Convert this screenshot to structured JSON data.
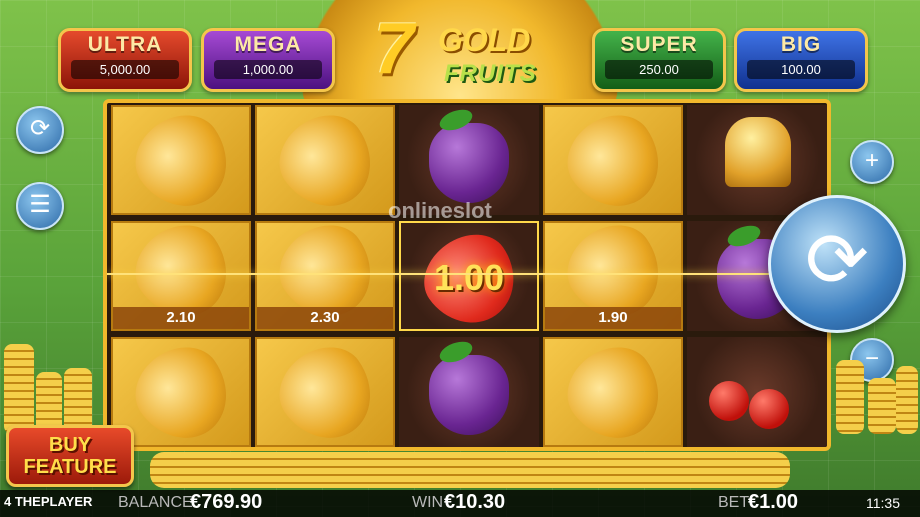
{
  "jackpots": [
    {
      "name": "ULTRA",
      "value": "5,000.00"
    },
    {
      "name": "MEGA",
      "value": "1,000.00"
    },
    {
      "name": "SUPER",
      "value": "250.00"
    },
    {
      "name": "BIG",
      "value": "100.00"
    }
  ],
  "logo": {
    "seven": "7",
    "gold": "GOLD",
    "fruits": "FRUITS"
  },
  "grid_values": {
    "r2c1": "2.10",
    "r2c2": "2.30",
    "r2c3": "1.00",
    "r2c4": "1.90"
  },
  "watermark": "onlineslot",
  "buy_feature": {
    "line1": "BUY",
    "line2": "FEATURE"
  },
  "bottom": {
    "brand": "4 THEPLAYER",
    "balance_label": "BALANCE",
    "balance_value": "€769.90",
    "win_label": "WIN",
    "win_value": "€10.30",
    "bet_label": "BET",
    "bet_value": "€1.00",
    "time": "11:35"
  },
  "icons": {
    "autoplay": "autoplay-icon",
    "menu": "menu-icon",
    "bet_plus": "plus-icon",
    "bet_minus": "minus-icon",
    "spin": "spin-icon"
  }
}
